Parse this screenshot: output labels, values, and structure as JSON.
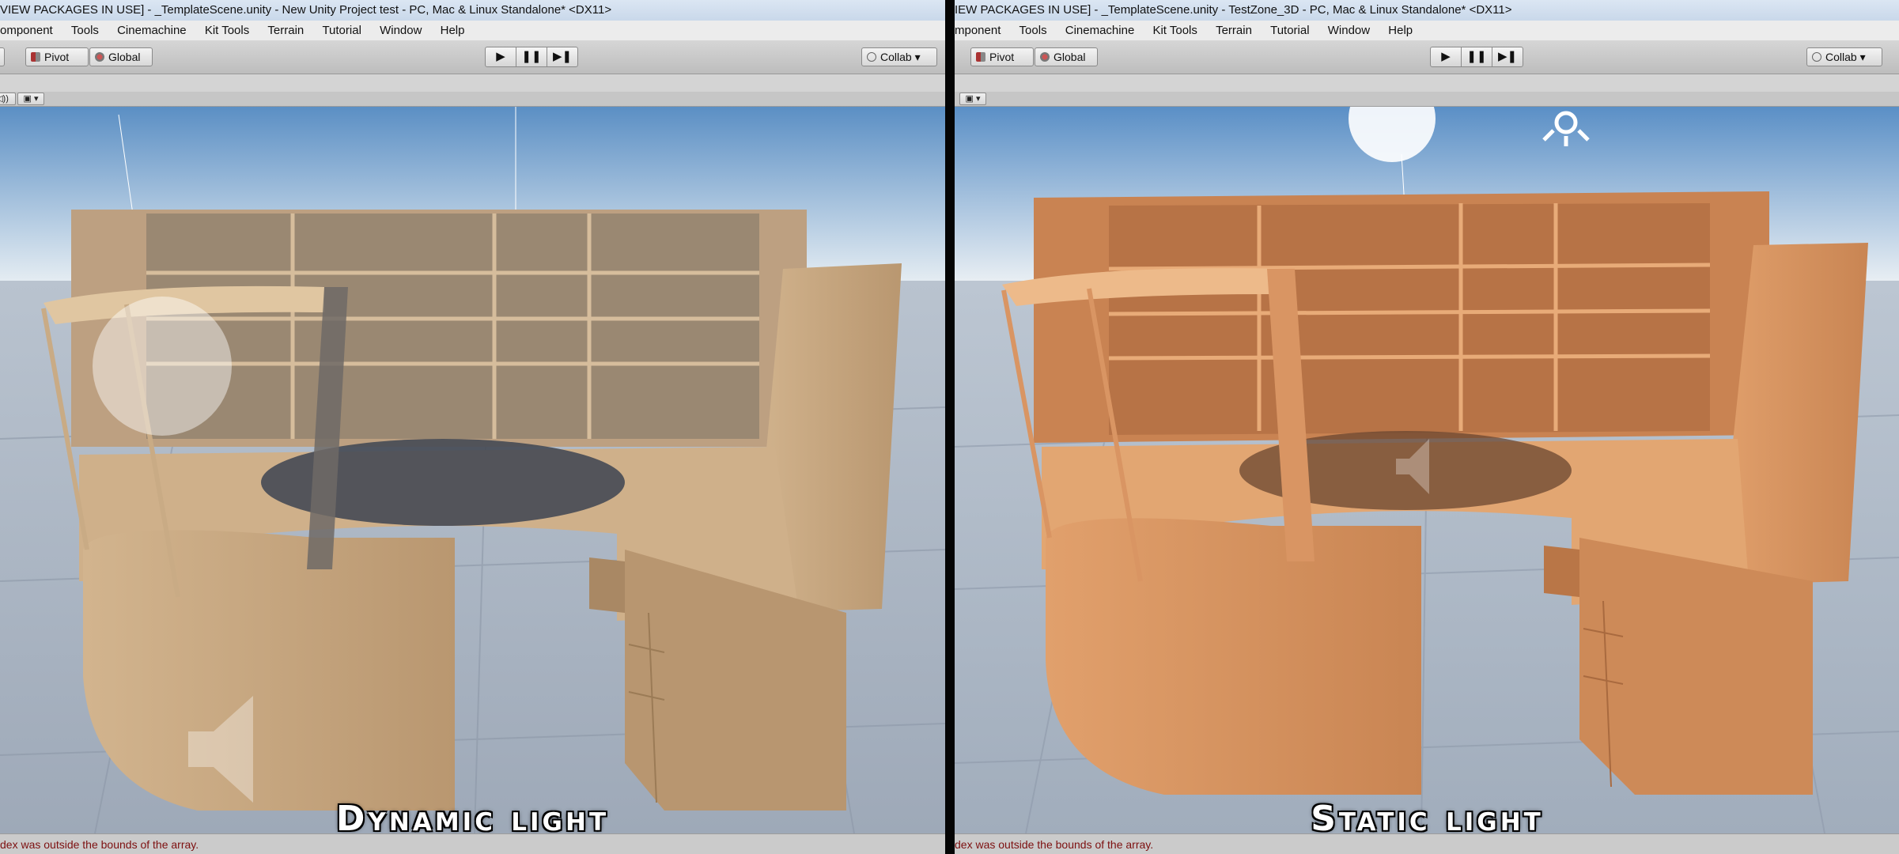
{
  "left": {
    "title": "VIEW PACKAGES IN USE] - _TemplateScene.unity - New Unity Project test - PC, Mac & Linux Standalone* <DX11>",
    "menu": [
      "omponent",
      "Tools",
      "Cinemachine",
      "Kit Tools",
      "Terrain",
      "Tutorial",
      "Window",
      "Help"
    ],
    "pivot_label": "Pivot",
    "global_label": "Global",
    "collab_label": "Collab ▾",
    "caption": "Dynamic light",
    "status": "dex was outside the bounds of the array."
  },
  "right": {
    "title": "IEW PACKAGES IN USE] - _TemplateScene.unity - TestZone_3D - PC, Mac & Linux Standalone* <DX11>",
    "menu": [
      "mponent",
      "Tools",
      "Cinemachine",
      "Kit Tools",
      "Terrain",
      "Tutorial",
      "Window",
      "Help"
    ],
    "pivot_label": "Pivot",
    "global_label": "Global",
    "collab_label": "Collab ▾",
    "caption": "Static light",
    "status": "dex was outside the bounds of the array."
  },
  "playback": {
    "play": "▶",
    "pause": "❚❚",
    "step": "▶❚"
  },
  "colors": {
    "dynamic_wood": "#c9a77e",
    "static_wood": "#d9915f",
    "sky_top": "#5b8fc4",
    "floor": "#a9b4c4",
    "status_text": "#7d1010"
  }
}
